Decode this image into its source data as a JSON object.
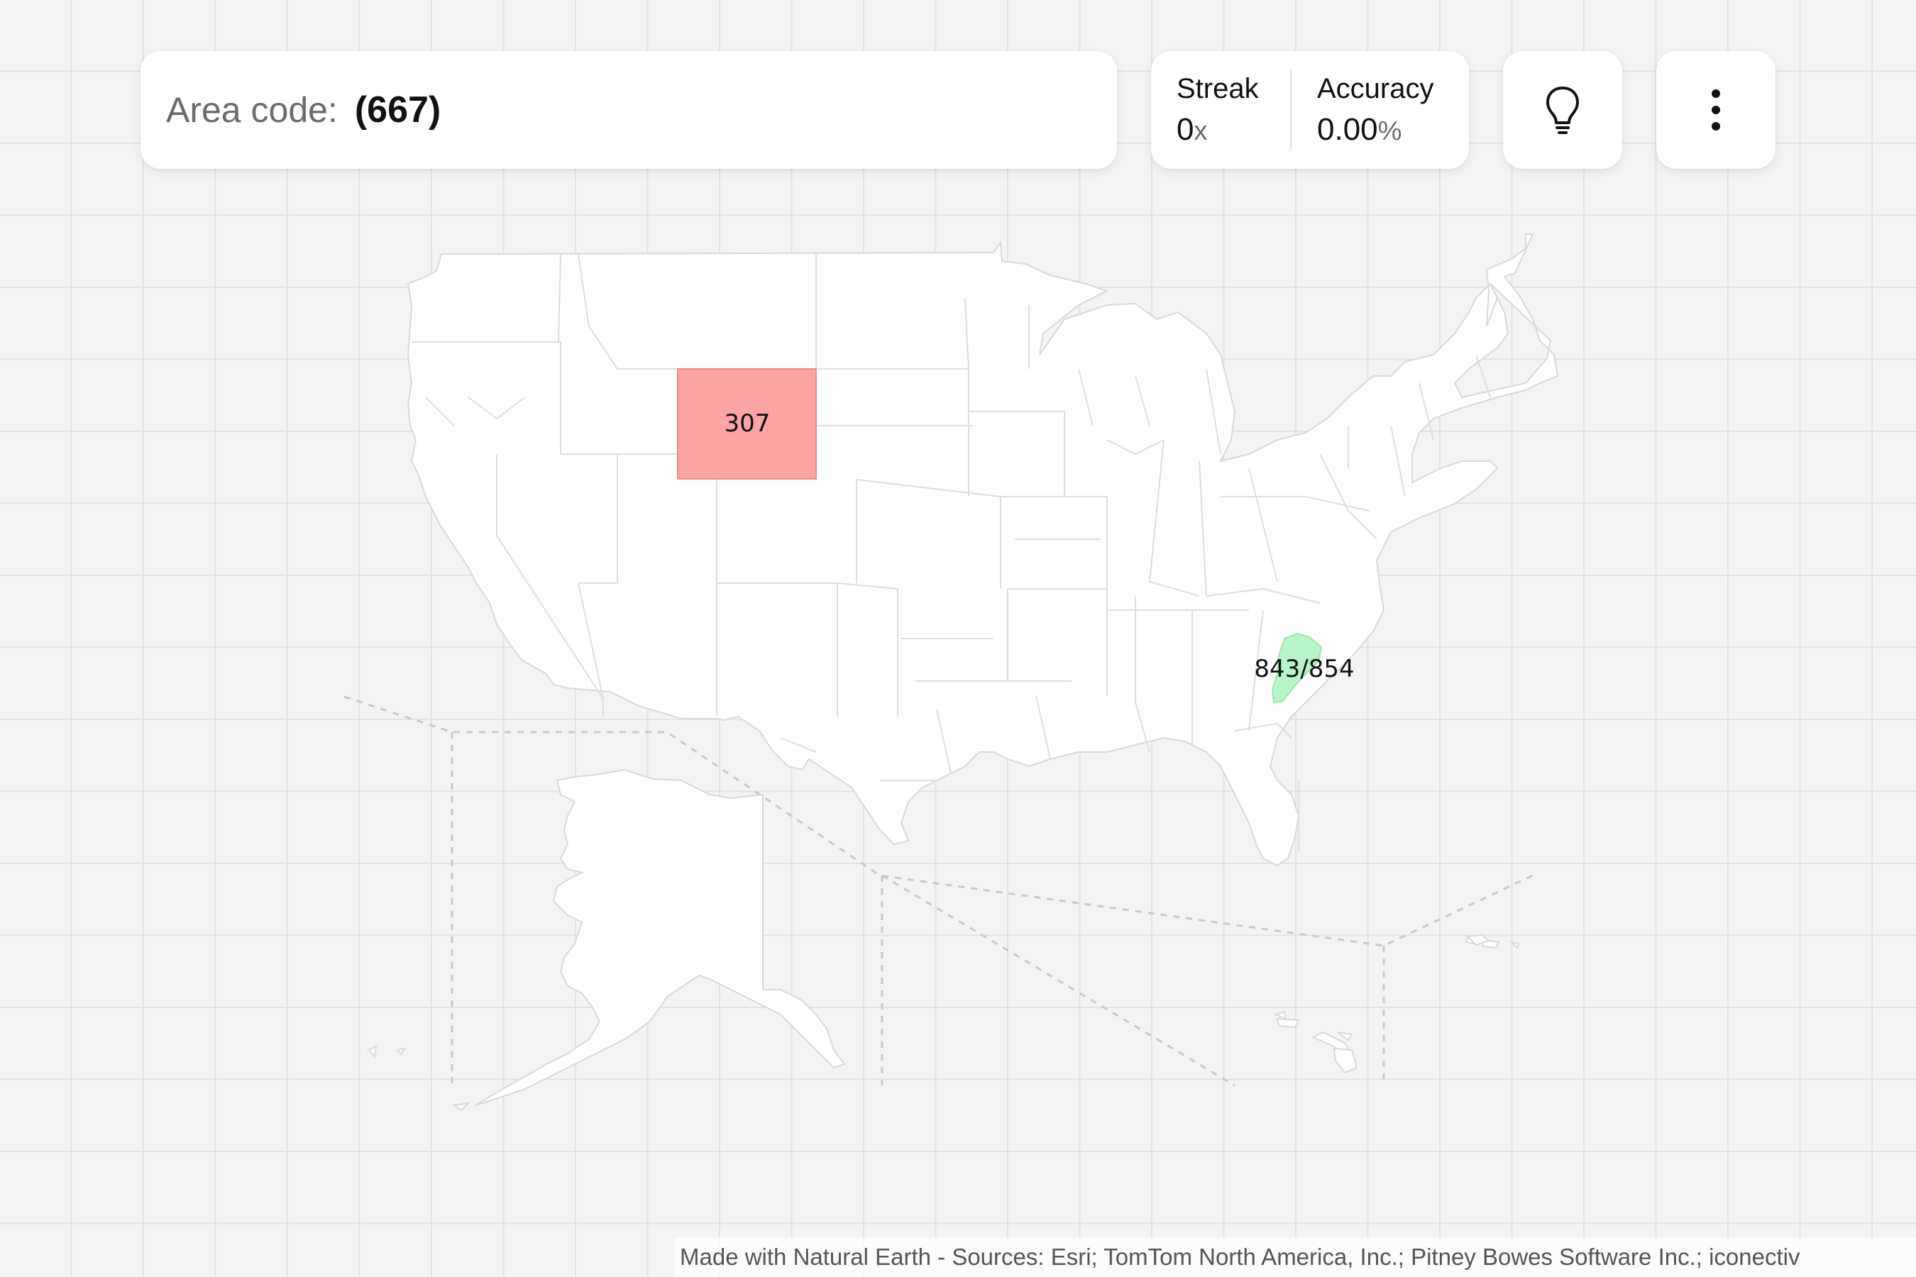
{
  "header": {
    "area_label": "Area code:",
    "area_value": "(667)"
  },
  "stats": {
    "streak_label": "Streak",
    "streak_value": "0",
    "streak_unit": "x",
    "accuracy_label": "Accuracy",
    "accuracy_value": "0.00",
    "accuracy_unit": "%"
  },
  "buttons": {
    "hint_icon": "lightbulb-icon",
    "menu_icon": "more-vertical-icon"
  },
  "map": {
    "wrong_guess": {
      "label": "307",
      "color": "#fca4a4"
    },
    "correct_answer": {
      "label": "843/854",
      "color": "#b7f5c8"
    }
  },
  "attribution": "Made with Natural Earth - Sources: Esri; TomTom North America, Inc.; Pitney Bowes Software Inc.; iconectiv"
}
